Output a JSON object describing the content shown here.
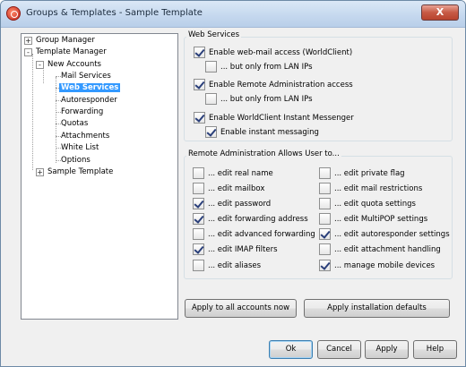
{
  "window": {
    "title": "Groups & Templates - Sample Template",
    "close_glyph": "X"
  },
  "tree": {
    "items": [
      {
        "label": "Group Manager",
        "expander": "+"
      },
      {
        "label": "Template Manager",
        "expander": "-"
      },
      {
        "label": "New Accounts",
        "expander": "-"
      },
      {
        "label": "Mail Services"
      },
      {
        "label": "Web Services",
        "selected": true
      },
      {
        "label": "Autoresponder"
      },
      {
        "label": "Forwarding"
      },
      {
        "label": "Quotas"
      },
      {
        "label": "Attachments"
      },
      {
        "label": "White List"
      },
      {
        "label": "Options"
      },
      {
        "label": "Sample Template",
        "expander": "+"
      }
    ]
  },
  "web_services": {
    "group_label": "Web Services",
    "options": [
      {
        "label": "Enable web-mail access (WorldClient)",
        "checked": true
      },
      {
        "label": "... but only from LAN IPs",
        "checked": false
      },
      {
        "label": "Enable Remote Administration access",
        "checked": true
      },
      {
        "label": "... but only from LAN IPs",
        "checked": false
      },
      {
        "label": "Enable WorldClient Instant Messenger",
        "checked": true
      },
      {
        "label": "Enable instant messaging",
        "checked": true
      }
    ]
  },
  "remote_admin": {
    "group_label": "Remote Administration Allows User to...",
    "left": [
      {
        "label": "... edit real name",
        "checked": false
      },
      {
        "label": "... edit mailbox",
        "checked": false
      },
      {
        "label": "... edit password",
        "checked": true
      },
      {
        "label": "... edit forwarding address",
        "checked": true
      },
      {
        "label": "... edit advanced forwarding",
        "checked": false
      },
      {
        "label": "... edit IMAP filters",
        "checked": true
      },
      {
        "label": "... edit aliases",
        "checked": false
      }
    ],
    "right": [
      {
        "label": "... edit private flag",
        "checked": false
      },
      {
        "label": "... edit mail restrictions",
        "checked": false
      },
      {
        "label": "... edit quota settings",
        "checked": false
      },
      {
        "label": "... edit MultiPOP settings",
        "checked": false
      },
      {
        "label": "... edit autoresponder settings",
        "checked": true
      },
      {
        "label": "... edit attachment handling",
        "checked": false
      },
      {
        "label": "... manage mobile devices",
        "checked": true
      }
    ]
  },
  "actions": {
    "apply_all": "Apply to all accounts now",
    "apply_defaults": "Apply installation defaults"
  },
  "footer": {
    "ok": "Ok",
    "cancel": "Cancel",
    "apply": "Apply",
    "help": "Help"
  }
}
